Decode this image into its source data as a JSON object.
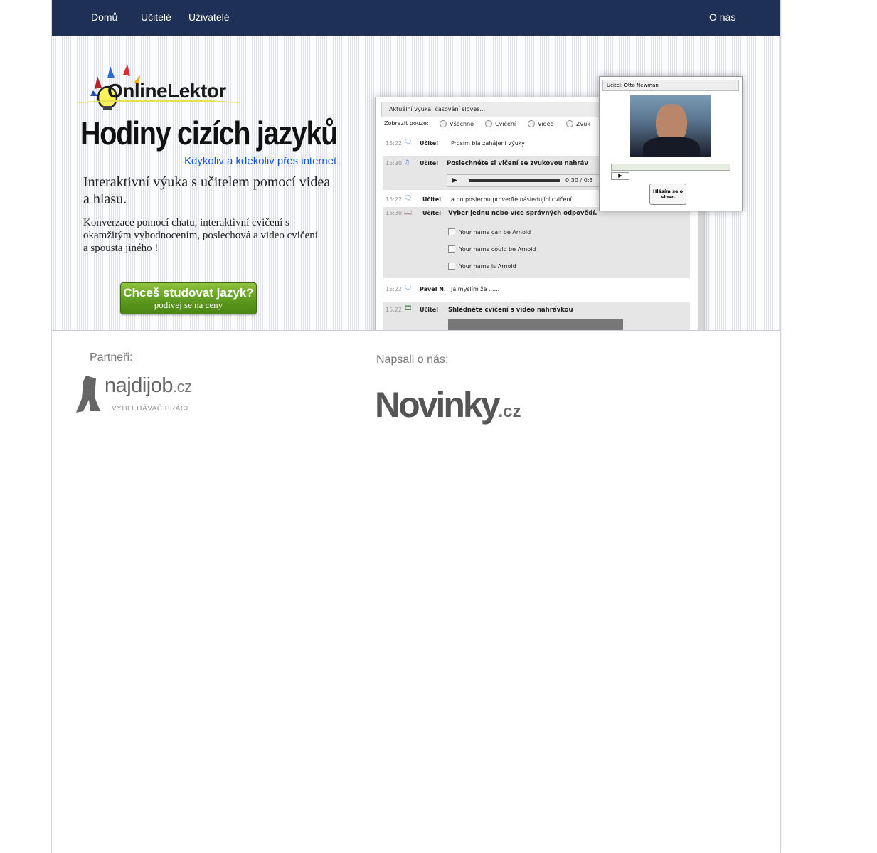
{
  "nav": {
    "home": "Domů",
    "teachers": "Učitelé",
    "users": "Uživatelé",
    "about": "O nás"
  },
  "hero": {
    "logo": "OnlineLektor",
    "headline": "Hodiny cizích jazyků",
    "subheadline": "Kdykoliv a kdekoliv přes internet",
    "intro": "Interaktivní výuka s učitelem pomocí videa a hlasu.",
    "description": "Konverzace pomocí chatu, interaktivní cvičení s okamžitým vyhodnocením, poslechová a video cvičení a spousta jiného !",
    "cta_line1": "Chceš studovat jazyk?",
    "cta_line2": "podívej se na ceny"
  },
  "lesson_preview": {
    "title": "Aktuální výuka: časování sloves...",
    "filter_label": "Zobrazit pouze:",
    "filters": [
      "Všechno",
      "Cvičení",
      "Video",
      "Zvuk"
    ],
    "rows": [
      {
        "time": "15:22",
        "who": "Učitel",
        "msg": "Prosím bla zahájení výuky"
      },
      {
        "time": "15:30",
        "who": "Učitel",
        "msg": "Poslechněte si vičení se zvukovou nahráv"
      },
      {
        "time": "15:22",
        "who": "Učitel",
        "msg": "a po poslechu proveďte následující cvičení"
      },
      {
        "time": "15:30",
        "who": "Učitel",
        "msg": "Vyber jednu nebo více správných odpovědí."
      },
      {
        "time": "15:22",
        "who": "Pavel N.",
        "msg": "Já myslím že ......"
      },
      {
        "time": "15:22",
        "who": "Učitel",
        "msg": "Shlédněte cvičení s video nahrávkou"
      }
    ],
    "player_time": "0:30 / 0:3",
    "answers": [
      "Your name can be Arnold",
      "Your name could be Arnold",
      "Your name is Arnold"
    ],
    "popup_title": "Učitel: Otto Newman",
    "popup_button": "Hlásím se o slovo"
  },
  "partners_label": "Partneři:",
  "partner": {
    "name": "najdijob",
    "tld": ".cz",
    "tagline": "VYHLEDÁVAČ PRÁCE"
  },
  "press_label": "Napsali o nás:",
  "press": {
    "name": "Novinky",
    "tld": ".cz"
  }
}
